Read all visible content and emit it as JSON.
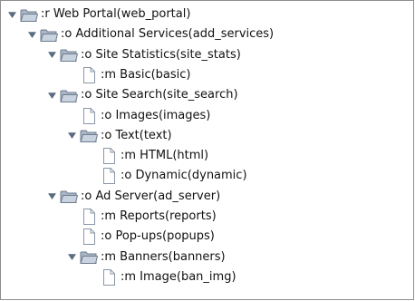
{
  "tree": {
    "nodes": [
      {
        "label": ":r Web Portal(web_portal)",
        "kind": "folder",
        "expanded": true,
        "depth": 0
      },
      {
        "label": ":o Additional Services(add_services)",
        "kind": "folder",
        "expanded": true,
        "depth": 1
      },
      {
        "label": ":o Site Statistics(site_stats)",
        "kind": "folder",
        "expanded": true,
        "depth": 2
      },
      {
        "label": ":m Basic(basic)",
        "kind": "leaf",
        "depth": 3
      },
      {
        "label": ":o Site Search(site_search)",
        "kind": "folder",
        "expanded": true,
        "depth": 2
      },
      {
        "label": ":o Images(images)",
        "kind": "leaf",
        "depth": 3
      },
      {
        "label": ":o Text(text)",
        "kind": "folder",
        "expanded": true,
        "depth": 3
      },
      {
        "label": ":m HTML(html)",
        "kind": "leaf",
        "depth": 4
      },
      {
        "label": ":o Dynamic(dynamic)",
        "kind": "leaf",
        "depth": 4
      },
      {
        "label": ":o Ad Server(ad_server)",
        "kind": "folder",
        "expanded": true,
        "depth": 2
      },
      {
        "label": ":m Reports(reports)",
        "kind": "leaf",
        "depth": 3
      },
      {
        "label": ":o Pop-ups(popups)",
        "kind": "leaf",
        "depth": 3
      },
      {
        "label": ":m Banners(banners)",
        "kind": "folder",
        "expanded": true,
        "depth": 3
      },
      {
        "label": ":m Image(ban_img)",
        "kind": "leaf",
        "depth": 4
      }
    ]
  },
  "icons": {
    "folder": "folder-open-icon",
    "leaf": "file-icon",
    "toggle": "expanded-triangle-icon"
  },
  "colors": {
    "folder_body": "#c9d3df",
    "folder_tab": "#a9b6c6",
    "folder_outline": "#6e7c8e",
    "file_fill": "#ffffff",
    "file_outline": "#8a96a6",
    "toggle": "#5a6b80"
  }
}
